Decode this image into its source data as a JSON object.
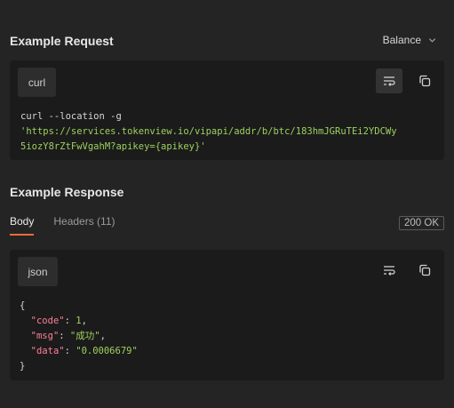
{
  "request": {
    "title": "Example Request",
    "language_selector": "Balance",
    "lang_chip": "curl",
    "code_line1": "curl --location -g",
    "code_line2": "'https://services.tokenview.io/vipapi/addr/b/btc/183hmJGRuTEi2YDCWy",
    "code_line3": "5iozY8rZtFwVgahM?apikey={apikey}'"
  },
  "response": {
    "title": "Example Response",
    "tabs": [
      "Body",
      "Headers (11)"
    ],
    "status": "200 OK",
    "lang_chip": "json",
    "json": {
      "open": "{",
      "close": "}",
      "lines": [
        {
          "key": "\"code\"",
          "value": "1"
        },
        {
          "key": "\"msg\"",
          "value": "\"成功\""
        },
        {
          "key": "\"data\"",
          "value": "\"0.0006679\""
        }
      ]
    }
  },
  "icons": {
    "wrap": "wrap-lines-icon",
    "copy": "copy-icon",
    "chevron": "chevron-down-icon"
  },
  "colors": {
    "background": "#242424",
    "card": "#1b1b1b",
    "string": "#9cd15f",
    "key": "#ff7f98",
    "accent": "#f26b3a"
  }
}
